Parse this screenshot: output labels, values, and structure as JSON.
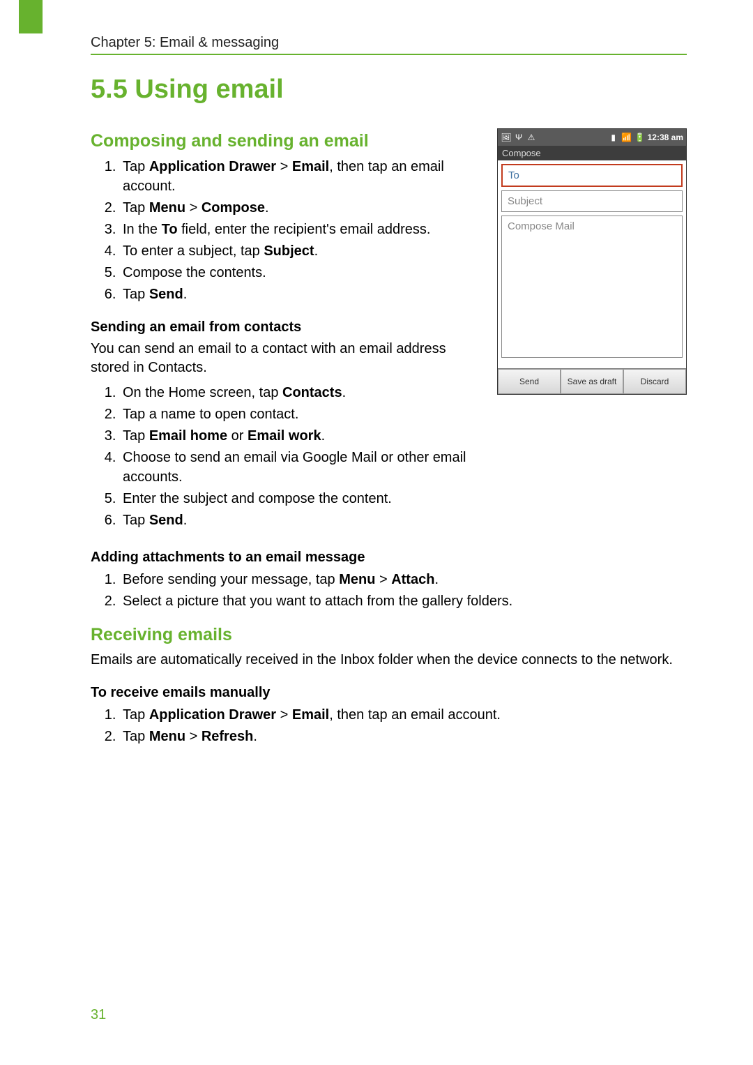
{
  "page_number": "31",
  "chapter_line": "Chapter 5: Email & messaging",
  "section_title": "5.5 Using email",
  "composing": {
    "heading": "Composing and sending an email",
    "steps": [
      {
        "pre": "Tap ",
        "b1": "Application Drawer",
        "mid": " > ",
        "b2": "Email",
        "post": ", then tap an email account."
      },
      {
        "pre": "Tap ",
        "b1": "Menu",
        "mid": " > ",
        "b2": "Compose",
        "post": "."
      },
      {
        "pre": "In the ",
        "b1": "To",
        "post": " field, enter the recipient's email address."
      },
      {
        "pre": "To enter a subject, tap ",
        "b1": "Subject",
        "post": "."
      },
      {
        "pre": "Compose the contents."
      },
      {
        "pre": "Tap ",
        "b1": "Send",
        "post": "."
      }
    ]
  },
  "from_contacts": {
    "heading": "Sending an email from contacts",
    "intro": "You can send an email to a contact with an email address stored in Contacts.",
    "steps": [
      {
        "pre": "On the Home screen, tap ",
        "b1": "Contacts",
        "post": "."
      },
      {
        "pre": "Tap a name to open contact."
      },
      {
        "pre": "Tap ",
        "b1": "Email home",
        "mid": " or ",
        "b2": "Email work",
        "post": "."
      },
      {
        "pre": "Choose to send an email via Google Mail or other email accounts."
      },
      {
        "pre": "Enter the subject and compose the content."
      },
      {
        "pre": "Tap ",
        "b1": "Send",
        "post": "."
      }
    ]
  },
  "attachments": {
    "heading": "Adding attachments to an email message",
    "steps": [
      {
        "pre": "Before sending your message, tap ",
        "b1": "Menu",
        "mid": " > ",
        "b2": "Attach",
        "post": "."
      },
      {
        "pre": "Select a picture that you want to attach from the gallery folders."
      }
    ]
  },
  "receiving": {
    "heading": "Receiving emails",
    "intro": "Emails are automatically received in the Inbox folder when the device connects to the network.",
    "sub_heading": "To receive emails manually",
    "steps": [
      {
        "pre": "Tap ",
        "b1": "Application Drawer",
        "mid": " > ",
        "b2": "Email",
        "post": ", then tap an email account."
      },
      {
        "pre": "Tap ",
        "b1": "Menu",
        "mid": " > ",
        "b2": "Refresh",
        "post": "."
      }
    ]
  },
  "screenshot": {
    "status_time": "12:38 am",
    "titlebar": "Compose",
    "to_placeholder": "To",
    "subject_placeholder": "Subject",
    "body_placeholder": "Compose Mail",
    "buttons": {
      "send": "Send",
      "draft": "Save as draft",
      "discard": "Discard"
    },
    "status_icons_left": [
      "image-icon",
      "usb-icon",
      "warning-icon"
    ],
    "status_icons_right": [
      "sim-icon",
      "signal-icon",
      "battery-icon"
    ]
  }
}
